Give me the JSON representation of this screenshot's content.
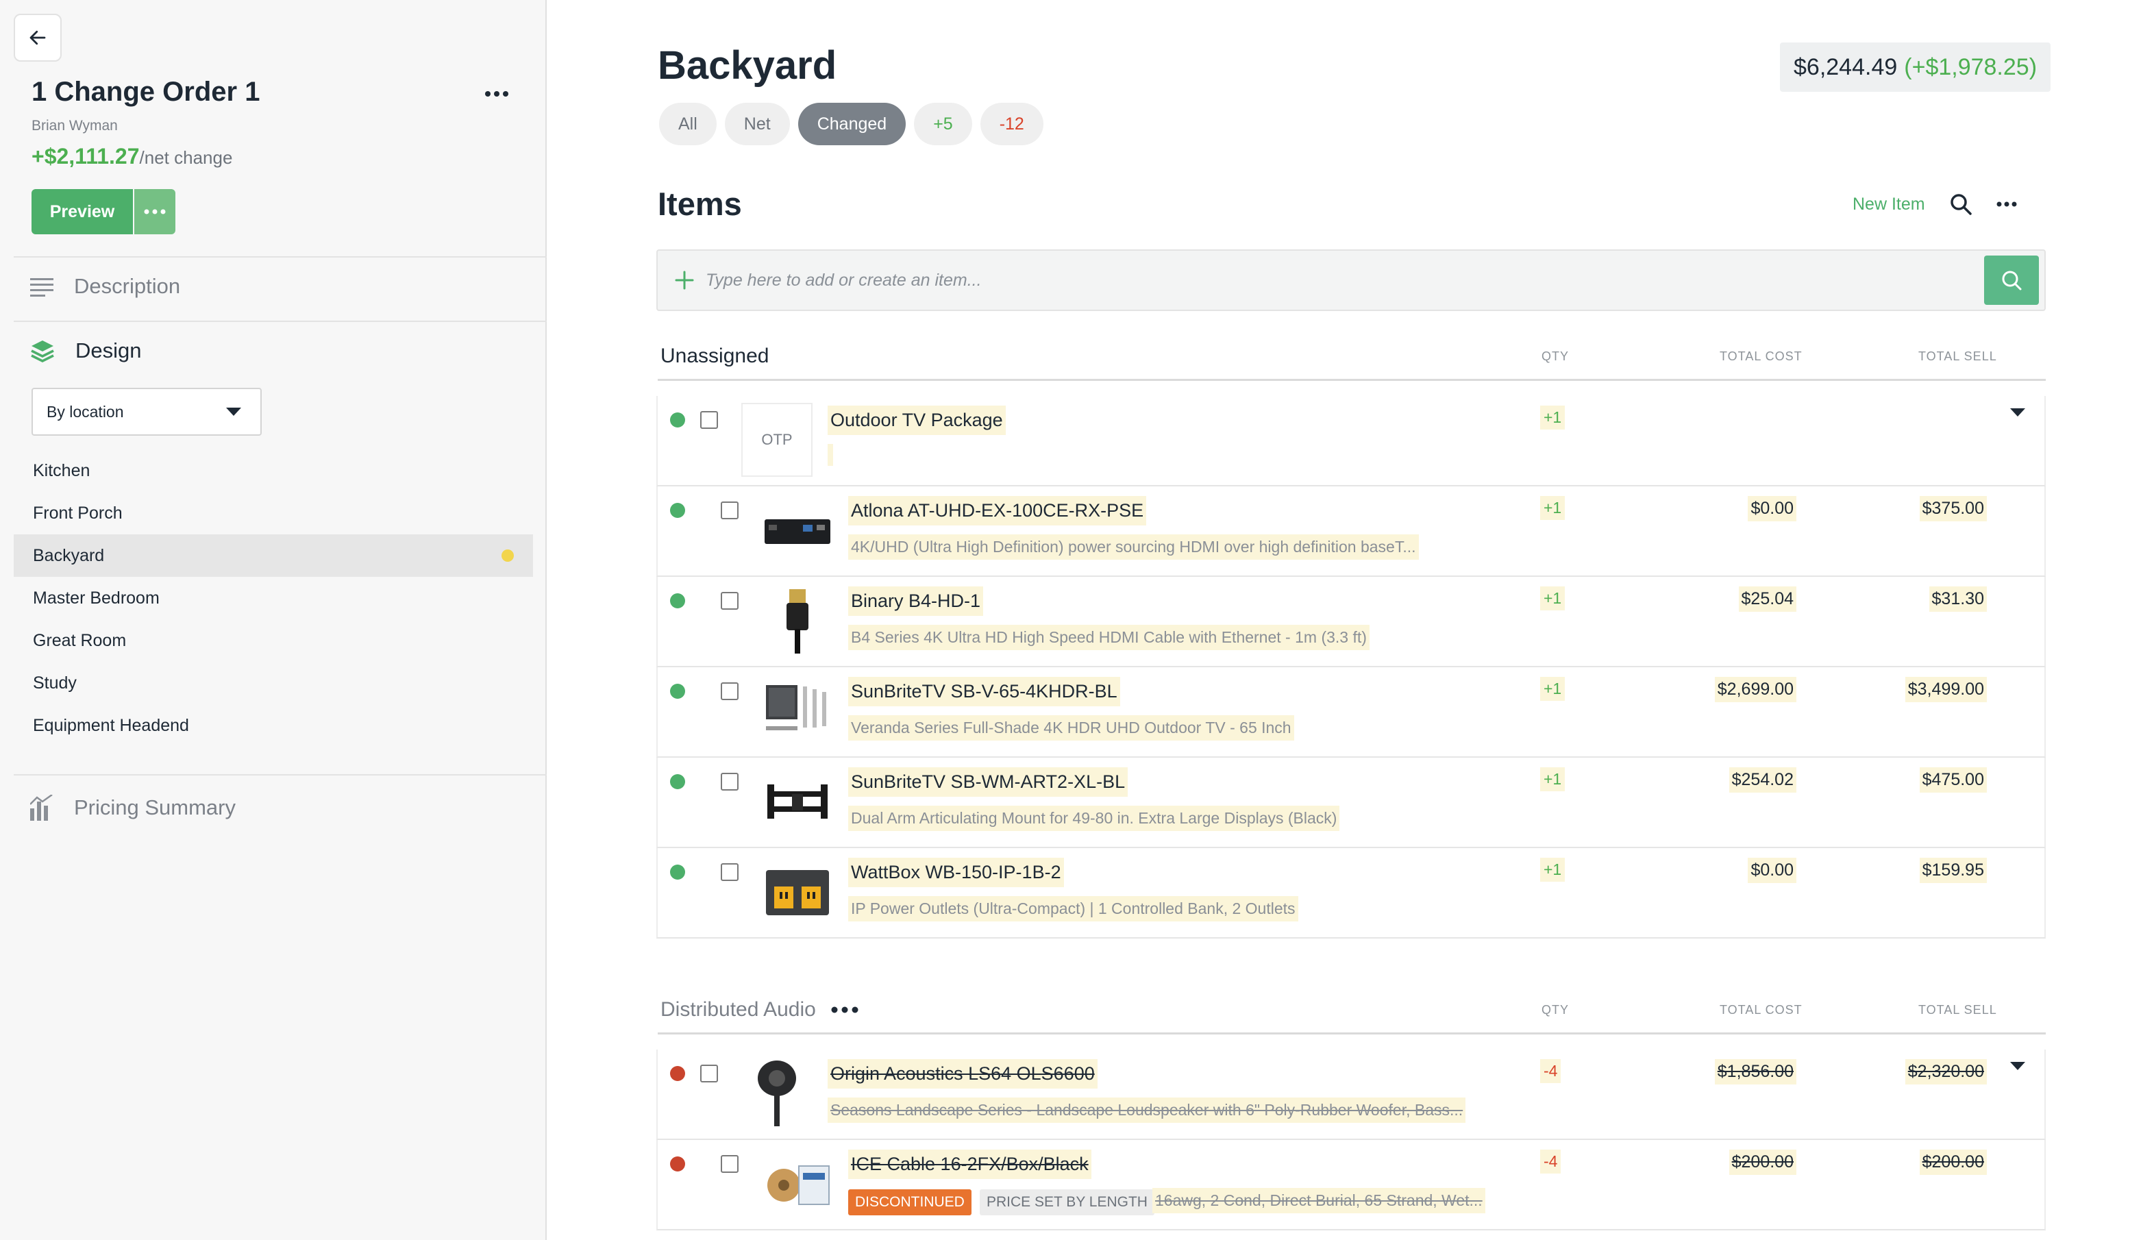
{
  "sidebar": {
    "title": "1 Change Order 1",
    "author": "Brian Wyman",
    "net_amount": "+$2,111.27",
    "net_label": "/net change",
    "preview_label": "Preview",
    "description_label": "Description",
    "design_label": "Design",
    "group_by_value": "By location",
    "locations": [
      {
        "label": "Kitchen"
      },
      {
        "label": "Front Porch"
      },
      {
        "label": "Backyard"
      },
      {
        "label": "Master Bedroom"
      },
      {
        "label": "Great Room"
      },
      {
        "label": "Study"
      },
      {
        "label": "Equipment Headend"
      }
    ],
    "active_location": "Backyard",
    "pricing_label": "Pricing Summary"
  },
  "main": {
    "title": "Backyard",
    "total": "$6,244.49",
    "total_change": "(+$1,978.25)",
    "filters": [
      "All",
      "Net",
      "Changed",
      "+5",
      "-12"
    ],
    "active_filter": "Changed",
    "items_title": "Items",
    "new_item_label": "New Item",
    "add_placeholder": "Type here to add or create an item...",
    "columns": {
      "qty": "QTY",
      "cost": "TOTAL COST",
      "sell": "TOTAL SELL"
    }
  },
  "groups": [
    {
      "name": "Unassigned",
      "items": [
        {
          "name": "Outdoor TV Package",
          "thumb": "OTP",
          "qty": "+1",
          "cost": "",
          "sell": "",
          "desc": ""
        },
        {
          "name": "Atlona AT-UHD-EX-100CE-RX-PSE",
          "desc": "4K/UHD (Ultra High Definition) power sourcing HDMI over high definition baseT...",
          "qty": "+1",
          "cost": "$0.00",
          "sell": "$375.00"
        },
        {
          "name": "Binary B4-HD-1",
          "desc": "B4 Series 4K Ultra HD High Speed HDMI Cable with Ethernet - 1m (3.3 ft)",
          "qty": "+1",
          "cost": "$25.04",
          "sell": "$31.30"
        },
        {
          "name": "SunBriteTV SB-V-65-4KHDR-BL",
          "desc": "Veranda Series Full-Shade 4K HDR UHD Outdoor TV - 65 Inch",
          "qty": "+1",
          "cost": "$2,699.00",
          "sell": "$3,499.00"
        },
        {
          "name": "SunBriteTV SB-WM-ART2-XL-BL",
          "desc": "Dual Arm Articulating Mount for 49-80 in. Extra Large Displays (Black)",
          "qty": "+1",
          "cost": "$254.02",
          "sell": "$475.00"
        },
        {
          "name": "WattBox WB-150-IP-1B-2",
          "desc": "IP Power Outlets (Ultra-Compact) | 1 Controlled Bank, 2 Outlets",
          "qty": "+1",
          "cost": "$0.00",
          "sell": "$159.95"
        }
      ]
    },
    {
      "name": "Distributed Audio",
      "items": [
        {
          "name": "Origin Acoustics LS64 OLS6600",
          "desc": "Seasons Landscape Series - Landscape Loudspeaker with 6\" Poly-Rubber Woofer, Bass...",
          "qty": "-4",
          "cost": "$1,856.00",
          "sell": "$2,320.00"
        },
        {
          "name": "ICE Cable 16-2FX/Box/Black",
          "badge_discontinued": "DISCONTINUED",
          "badge_length": "PRICE SET BY LENGTH",
          "desc": "16awg, 2 Cond, Direct Burial, 65 Strand, Wet...",
          "qty": "-4",
          "cost": "$200.00",
          "sell": "$200.00"
        }
      ]
    }
  ],
  "colors": {
    "accent": "#4caf6a",
    "negative": "#d9432a",
    "highlight": "#fbf5d9"
  }
}
